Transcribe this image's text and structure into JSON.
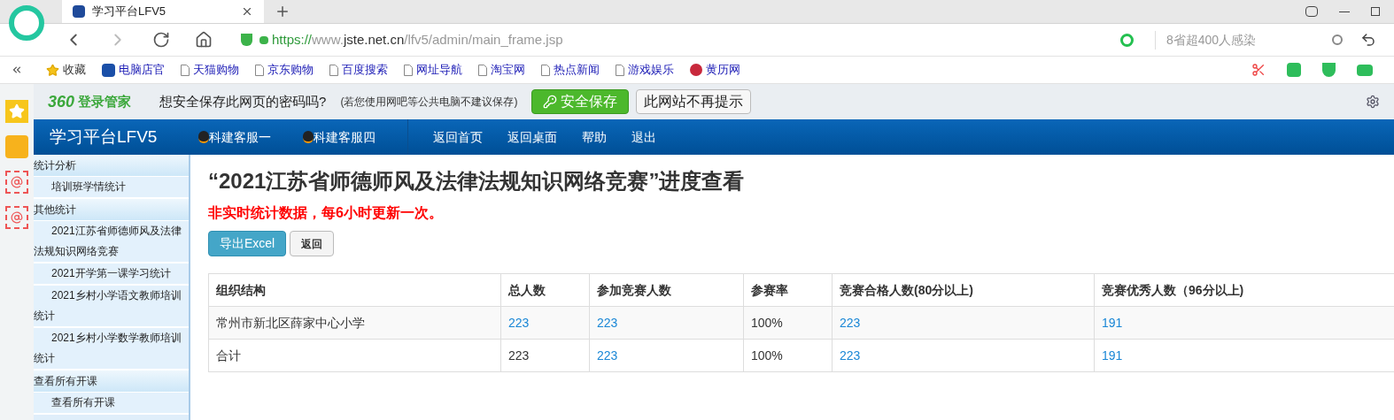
{
  "browser": {
    "tab": {
      "title": "学习平台LFV5",
      "selected": true
    },
    "address": {
      "scheme": "https://",
      "host": "www.jste.net.cn",
      "path": "/lfv5/admin/main_frame.jsp"
    },
    "search": {
      "placeholder": "8省超400人感染"
    },
    "bookmarks": [
      {
        "label": "收藏",
        "kind": "star"
      },
      {
        "label": "电脑店官",
        "kind": "brand"
      },
      {
        "label": "天猫购物",
        "kind": "page"
      },
      {
        "label": "京东购物",
        "kind": "page"
      },
      {
        "label": "百度搜索",
        "kind": "page"
      },
      {
        "label": "网址导航",
        "kind": "page"
      },
      {
        "label": "淘宝网",
        "kind": "page"
      },
      {
        "label": "热点新闻",
        "kind": "page"
      },
      {
        "label": "游戏娱乐",
        "kind": "page"
      },
      {
        "label": "黄历网",
        "kind": "yin"
      }
    ]
  },
  "password_bar": {
    "brand": "360",
    "brand_label": "登录管家",
    "question": "想安全保存此网页的密码吗?",
    "note": "(若您使用网吧等公共电脑不建议保存)",
    "save": "安全保存",
    "never": "此网站不再提示"
  },
  "nav": {
    "title": "学习平台LFV5",
    "services": [
      "科建客服一",
      "科建客服四"
    ],
    "links": [
      "返回首页",
      "返回桌面",
      "帮助",
      "退出"
    ]
  },
  "sidebar": {
    "items": [
      {
        "label": "统计分析",
        "kind": "section"
      },
      {
        "label": "培训班学情统计",
        "kind": "item"
      },
      {
        "label": "其他统计",
        "kind": "section"
      },
      {
        "label": "2021江苏省师德师风及法律法规知识网络竞赛",
        "kind": "item"
      },
      {
        "label": "2021开学第一课学习统计",
        "kind": "item"
      },
      {
        "label": "2021乡村小学语文教师培训统计",
        "kind": "item"
      },
      {
        "label": "2021乡村小学数学教师培训统计",
        "kind": "item"
      },
      {
        "label": "查看所有开课",
        "kind": "section"
      },
      {
        "label": "查看所有开课",
        "kind": "item"
      }
    ]
  },
  "page": {
    "title": "“2021江苏省师德师风及法律法规知识网络竞赛”进度查看",
    "notice": "非实时统计数据，每6小时更新一次。",
    "buttons": [
      {
        "label": "导出Excel",
        "kind": "primary"
      },
      {
        "label": "返回",
        "kind": "default"
      }
    ]
  },
  "table": {
    "columns": [
      "组织结构",
      "总人数",
      "参加竞赛人数",
      "参赛率",
      "竞赛合格人数(80分以上)",
      "竞赛优秀人数（96分以上)"
    ],
    "rows": [
      [
        {
          "text": "常州市新北区薛家中心小学",
          "link": false
        },
        {
          "text": "223",
          "link": true
        },
        {
          "text": "223",
          "link": true
        },
        {
          "text": "100%",
          "link": false
        },
        {
          "text": "223",
          "link": true
        },
        {
          "text": "191",
          "link": true
        }
      ],
      [
        {
          "text": "合计",
          "link": false
        },
        {
          "text": "223",
          "link": false
        },
        {
          "text": "223",
          "link": true
        },
        {
          "text": "100%",
          "link": false
        },
        {
          "text": "223",
          "link": true
        },
        {
          "text": "191",
          "link": true
        }
      ]
    ]
  }
}
